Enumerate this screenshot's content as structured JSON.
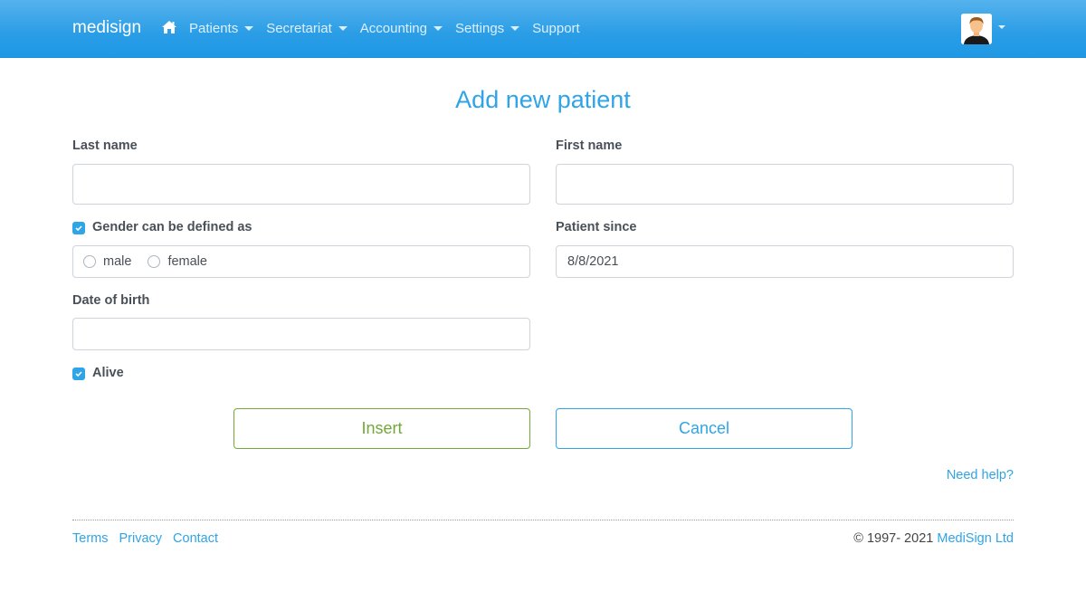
{
  "navbar": {
    "brand": "medisign",
    "home_icon": "home-icon",
    "items": [
      {
        "label": "Patients",
        "dropdown": true
      },
      {
        "label": "Secretariat",
        "dropdown": true
      },
      {
        "label": "Accounting",
        "dropdown": true
      },
      {
        "label": "Settings",
        "dropdown": true
      },
      {
        "label": "Support",
        "dropdown": false
      }
    ],
    "user_icon": "user-avatar-icon"
  },
  "page": {
    "title": "Add new patient"
  },
  "form": {
    "last_name": {
      "label": "Last name",
      "value": "",
      "placeholder": ""
    },
    "first_name": {
      "label": "First name",
      "value": "",
      "placeholder": ""
    },
    "gender": {
      "label": "Gender can be defined as",
      "checked": true,
      "options": [
        {
          "label": "male",
          "selected": false
        },
        {
          "label": "female",
          "selected": false
        }
      ]
    },
    "patient_since": {
      "label": "Patient since",
      "value": "8/8/2021"
    },
    "date_of_birth": {
      "label": "Date of birth",
      "value": "",
      "placeholder": ""
    },
    "alive": {
      "label": "Alive",
      "checked": true
    },
    "insert_label": "Insert",
    "cancel_label": "Cancel",
    "help_link": "Need help?"
  },
  "footer": {
    "links": [
      "Terms",
      "Privacy",
      "Contact"
    ],
    "copyright": "© 1997- 2021 ",
    "company_link": "MediSign Ltd"
  },
  "colors": {
    "primary": "#2fa4e7",
    "success": "#73a839",
    "navbar": "#2a9de6"
  }
}
